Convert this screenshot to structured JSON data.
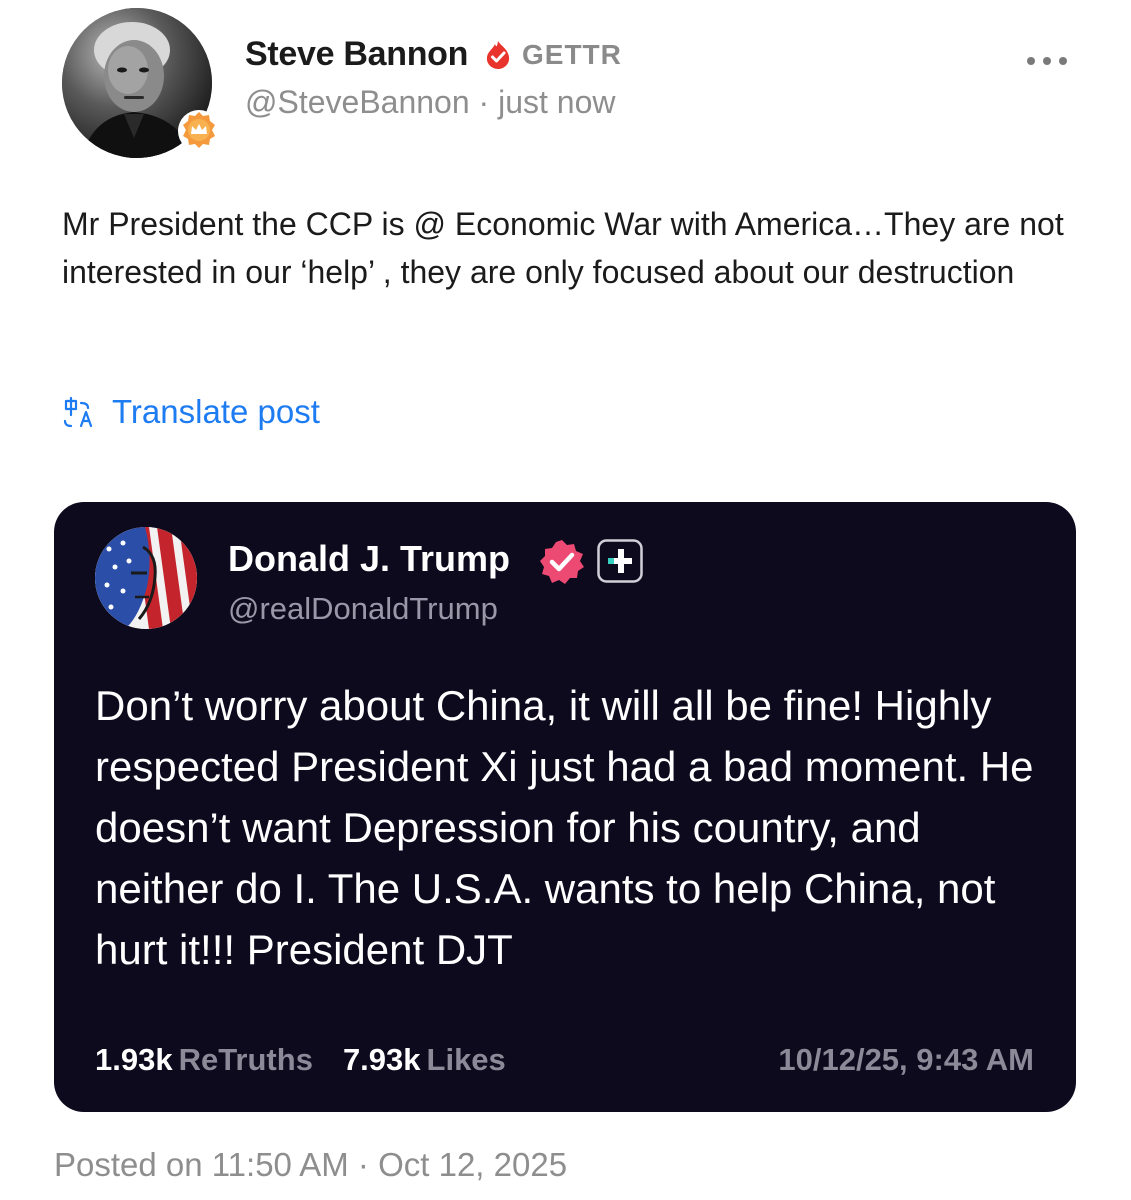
{
  "author": {
    "display_name": "Steve Bannon",
    "platform_label": "GETTR",
    "handle_line": "@SteveBannon · just now",
    "avatar_icon": "profile-photo",
    "badge_icon": "crown-badge-icon",
    "verified_icon": "flame-verified-icon",
    "accent_color": "#e8342c"
  },
  "more_menu": {
    "icon": "more-dots-icon",
    "label": "•••"
  },
  "post": {
    "text": "Mr President the CCP is @ Economic War with America…They are not interested in our ‘help’ , they are only focused about our destruction",
    "translate_label": "Translate post",
    "translate_color": "#1e7cf2",
    "posted_on": "Posted on 11:50 AM · Oct 12, 2025"
  },
  "quoted": {
    "display_name": "Donald J. Trump",
    "handle": "@realDonaldTrump",
    "verified_icon": "verified-badge-icon",
    "plus_icon": "truth-social-plus-icon",
    "verified_color": "#ec4a73",
    "background_color": "#0c0a1c",
    "text": "Don’t worry about China, it will all be fine! Highly respected President Xi just had a bad moment. He doesn’t want Depression for his country, and neither do I. The U.S.A. wants to help China, not hurt it!!! President DJT",
    "retruths_count": "1.93k",
    "retruths_label": "ReTruths",
    "likes_count": "7.93k",
    "likes_label": "Likes",
    "timestamp": "10/12/25, 9:43 AM"
  }
}
